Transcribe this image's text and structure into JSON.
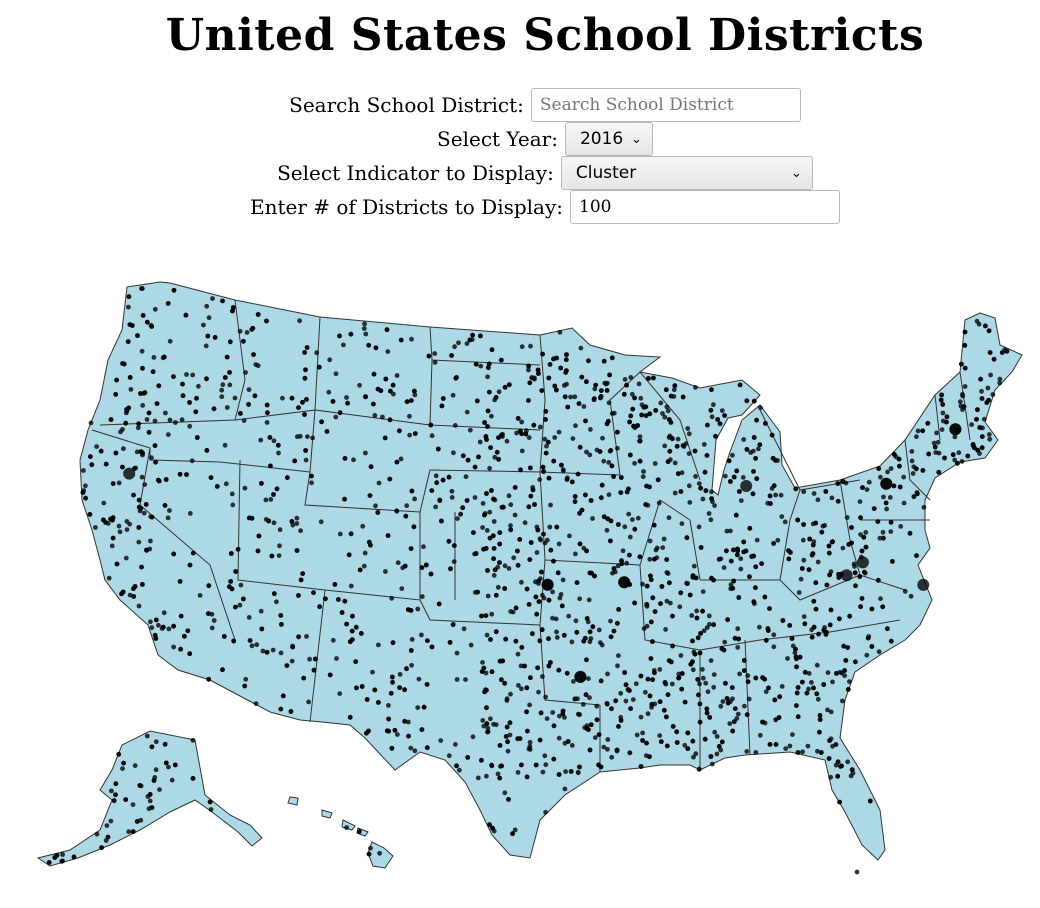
{
  "title": "United States School Districts",
  "controls": {
    "search_label": "Search School District:",
    "search_placeholder": "Search School District",
    "search_value": "",
    "year_label": "Select Year:",
    "year_value": "2016",
    "indicator_label": "Select Indicator to Display:",
    "indicator_value": "Cluster",
    "count_label": "Enter # of Districts to Display:",
    "count_value": "100"
  },
  "map": {
    "land_color": "#add8e6",
    "border_color": "#333333",
    "marker_color": "#000000",
    "marker_icon": "district-point-icon"
  }
}
